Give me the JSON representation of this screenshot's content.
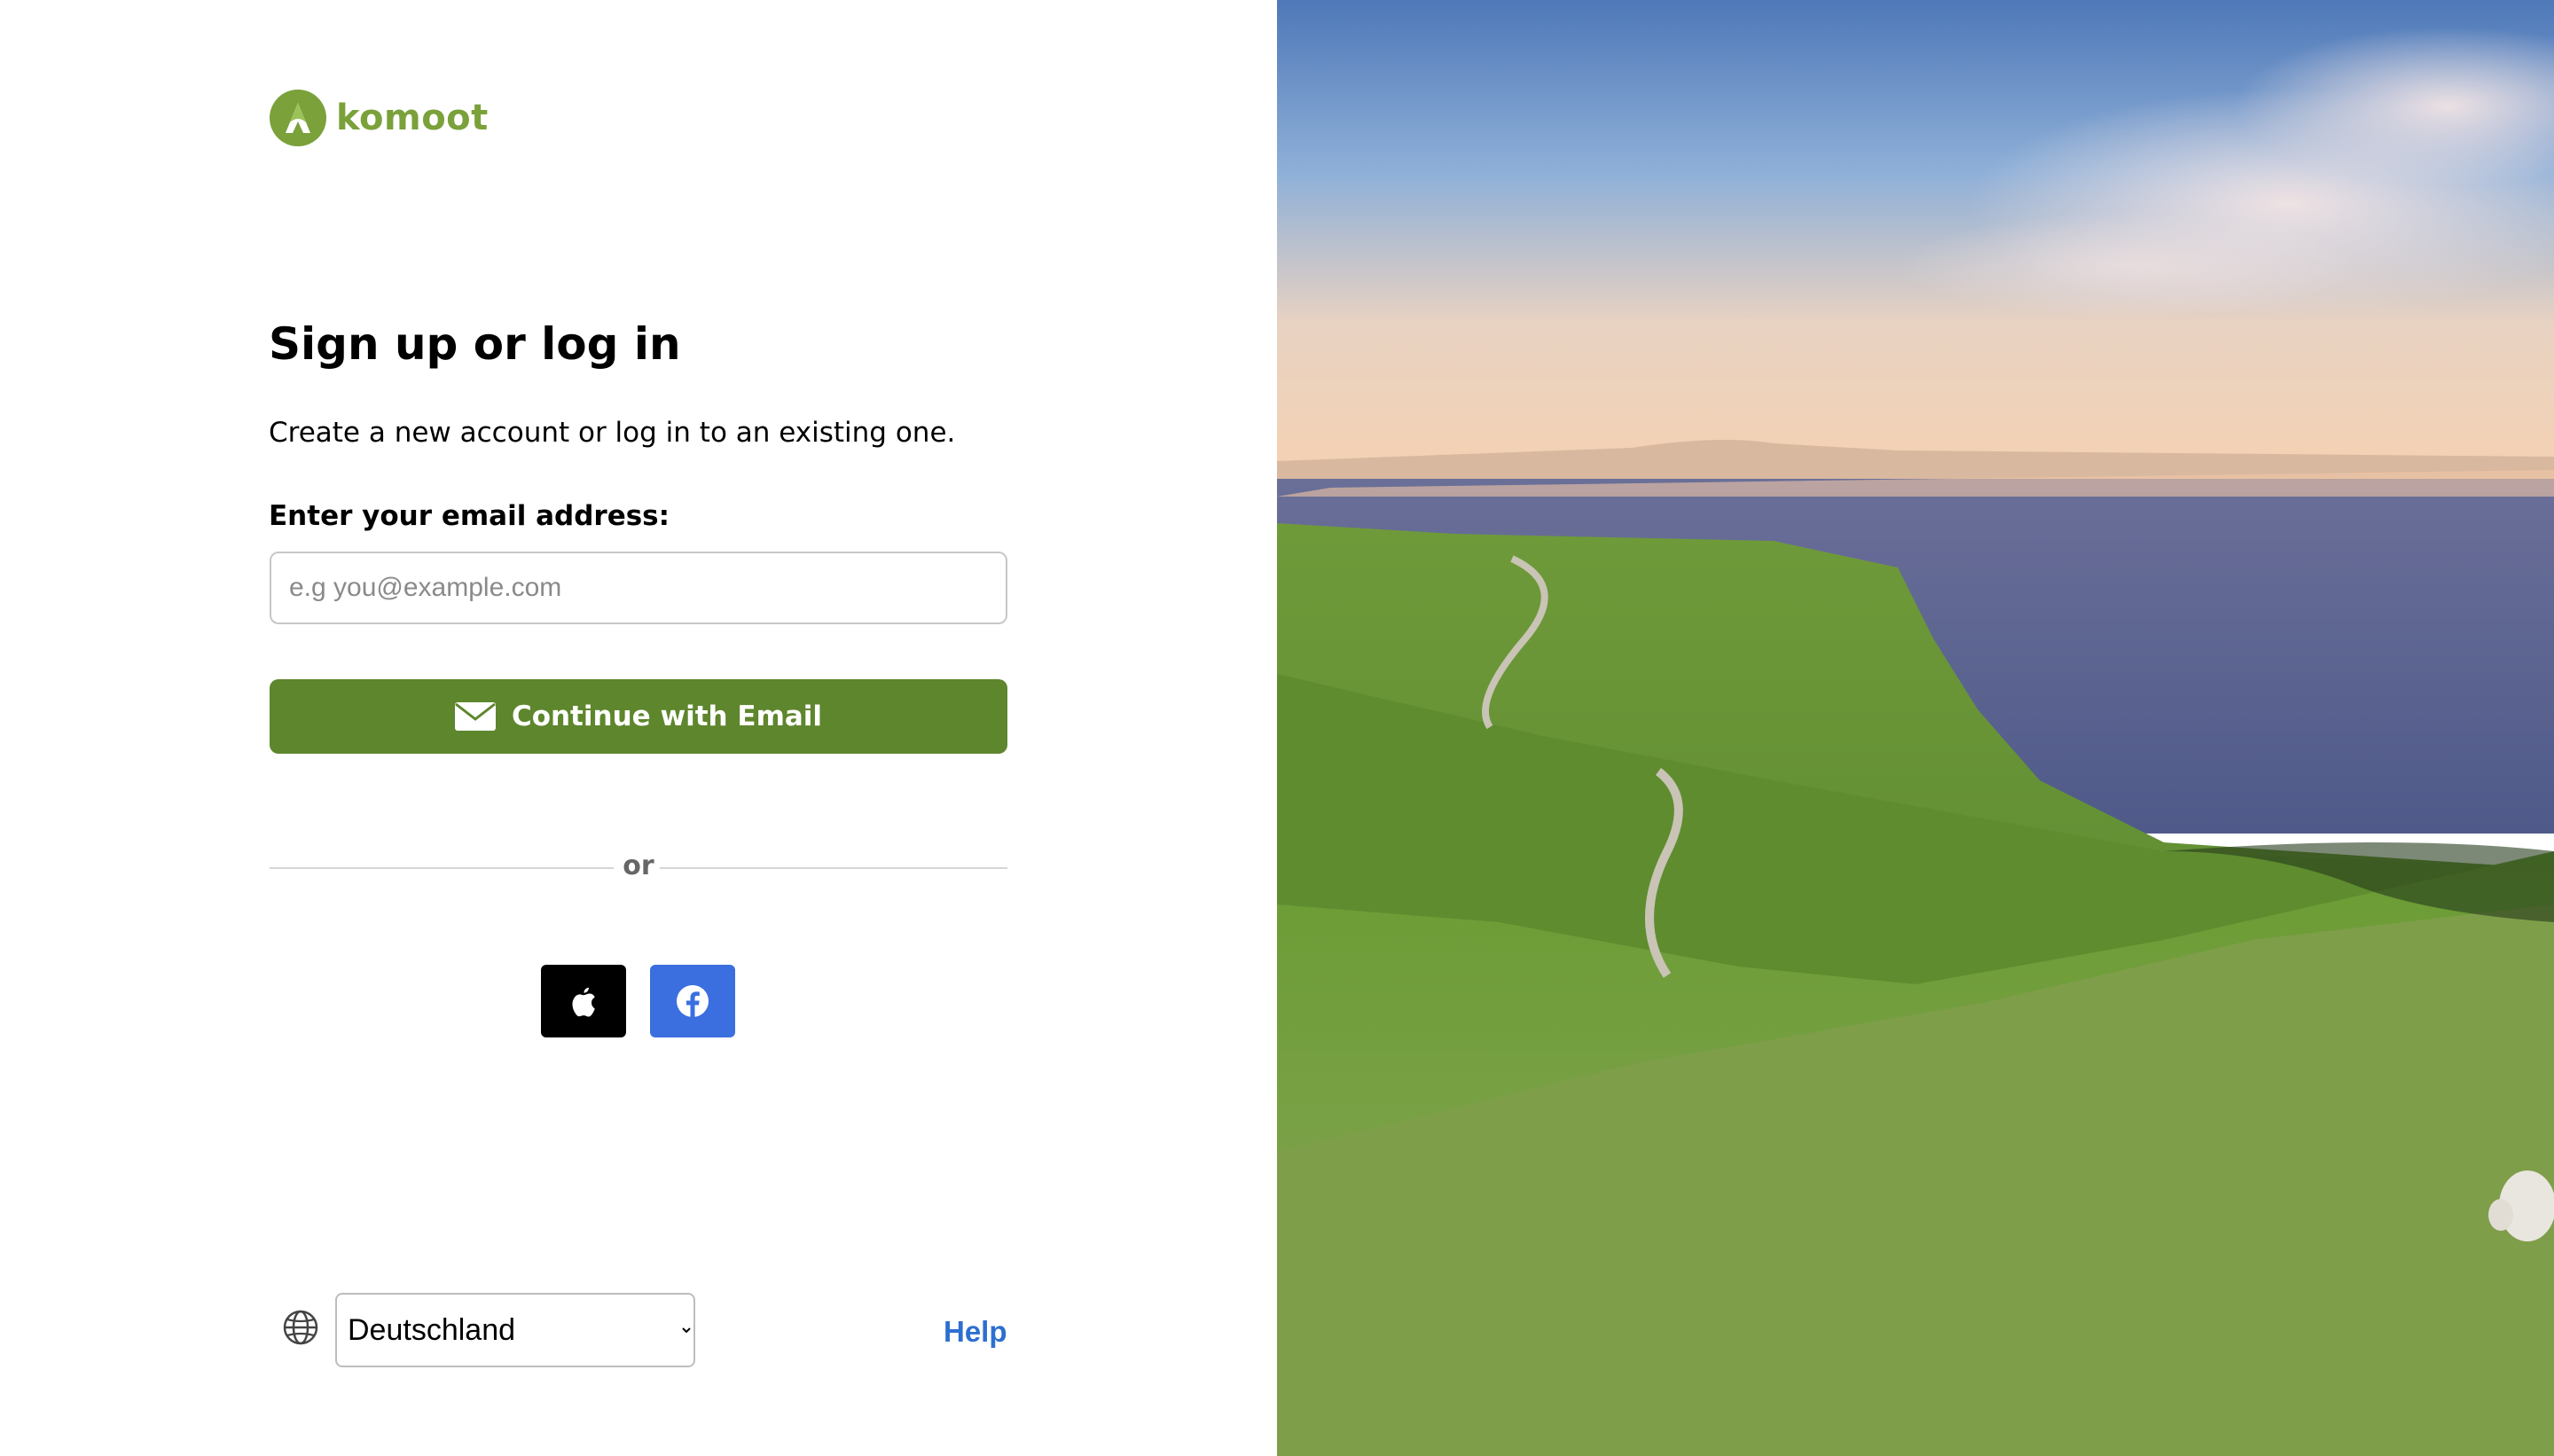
{
  "brand": {
    "name": "komoot",
    "color": "#7aa13a",
    "icon": "komoot-logo-icon"
  },
  "auth": {
    "title": "Sign up or log in",
    "subtitle": "Create a new account or log in to an existing one.",
    "email_label": "Enter your email address:",
    "email_placeholder": "e.g you@example.com",
    "email_value": "",
    "continue_label": "Continue with Email",
    "continue_icon": "mail-icon",
    "primary_color": "#5e862d",
    "divider_text": "or",
    "social": [
      {
        "name": "apple",
        "icon": "apple-icon",
        "color": "#000000"
      },
      {
        "name": "facebook",
        "icon": "facebook-icon",
        "color": "#3b6fe0"
      }
    ]
  },
  "footer": {
    "country_icon": "globe-icon",
    "country_selected": "Deutschland",
    "help_label": "Help",
    "help_color": "#2d6fd0"
  },
  "hero": {
    "image": "coastal-green-hills-landscape"
  }
}
